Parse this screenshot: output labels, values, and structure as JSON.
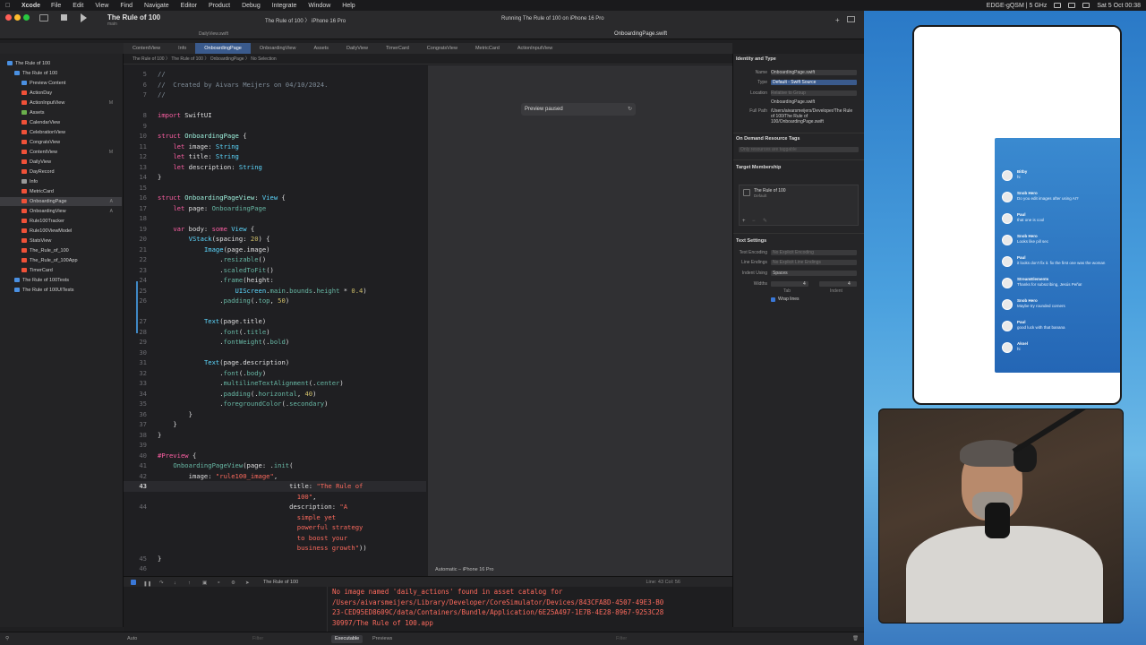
{
  "menubar": {
    "app": "Xcode",
    "items": [
      "File",
      "Edit",
      "View",
      "Find",
      "Navigate",
      "Editor",
      "Product",
      "Debug",
      "Integrate",
      "Window",
      "Help"
    ],
    "network": "EDGE-gQSM | 5 GHz",
    "clock": "Sat 5 Oct 00:38"
  },
  "toolbar": {
    "project": "The Rule of 100",
    "project_sub": "main",
    "scheme": "The Rule of 100  〉  iPhone 16 Pro",
    "status": "Running The Rule of 100 on iPhone 16 Pro",
    "active_file": "OnboardingPage.swift",
    "daily_tab": "DailyView.swift"
  },
  "tabs": [
    "ContentView",
    "Info",
    "OnboardingPage",
    "OnboardingView",
    "Assets",
    "DailyView",
    "TimerCard",
    "CongratsView",
    "MetricCard",
    "ActionInputView"
  ],
  "jumpbar": "The Rule of 100  〉  The Rule of 100  〉  OnboardingPage  〉  No Selection",
  "navigator": {
    "items": [
      {
        "label": "The Rule of 100",
        "indent": 0,
        "kind": "project",
        "badge": ""
      },
      {
        "label": "The Rule of 100",
        "indent": 1,
        "kind": "folder",
        "badge": ""
      },
      {
        "label": "Preview Content",
        "indent": 2,
        "kind": "folder",
        "badge": ""
      },
      {
        "label": "ActionDay",
        "indent": 2,
        "kind": "swift",
        "badge": ""
      },
      {
        "label": "ActionInputView",
        "indent": 2,
        "kind": "swift",
        "badge": "M"
      },
      {
        "label": "Assets",
        "indent": 2,
        "kind": "asset",
        "badge": ""
      },
      {
        "label": "CalendarView",
        "indent": 2,
        "kind": "swift",
        "badge": ""
      },
      {
        "label": "CelebrationView",
        "indent": 2,
        "kind": "swift",
        "badge": ""
      },
      {
        "label": "CongratsView",
        "indent": 2,
        "kind": "swift",
        "badge": ""
      },
      {
        "label": "ContentView",
        "indent": 2,
        "kind": "swift",
        "badge": "M"
      },
      {
        "label": "DailyView",
        "indent": 2,
        "kind": "swift",
        "badge": ""
      },
      {
        "label": "DayRecord",
        "indent": 2,
        "kind": "swift",
        "badge": ""
      },
      {
        "label": "Info",
        "indent": 2,
        "kind": "plist",
        "badge": ""
      },
      {
        "label": "MetricCard",
        "indent": 2,
        "kind": "swift",
        "badge": ""
      },
      {
        "label": "OnboardingPage",
        "indent": 2,
        "kind": "swift",
        "badge": "A"
      },
      {
        "label": "OnboardingView",
        "indent": 2,
        "kind": "swift",
        "badge": "A"
      },
      {
        "label": "Rule100Tracker",
        "indent": 2,
        "kind": "swift",
        "badge": ""
      },
      {
        "label": "Rule100ViewModel",
        "indent": 2,
        "kind": "swift",
        "badge": ""
      },
      {
        "label": "StatsView",
        "indent": 2,
        "kind": "swift",
        "badge": ""
      },
      {
        "label": "The_Rule_of_100",
        "indent": 2,
        "kind": "swift",
        "badge": ""
      },
      {
        "label": "The_Rule_of_100App",
        "indent": 2,
        "kind": "swift",
        "badge": ""
      },
      {
        "label": "TimerCard",
        "indent": 2,
        "kind": "swift",
        "badge": ""
      },
      {
        "label": "The Rule of 100Tests",
        "indent": 1,
        "kind": "folder",
        "badge": ""
      },
      {
        "label": "The Rule of 100UITests",
        "indent": 1,
        "kind": "folder",
        "badge": ""
      }
    ],
    "selected_index": 14
  },
  "code": [
    {
      "n": "5",
      "h": "<span class=\"cm\">//</span>"
    },
    {
      "n": "6",
      "h": "<span class=\"cm\">//  Created by Aivars Meijers on 04/10/2024.</span>"
    },
    {
      "n": "7",
      "h": "<span class=\"cm\">//</span>"
    },
    {
      "n": "",
      "h": ""
    },
    {
      "n": "8",
      "h": "<span class=\"kw\">import</span> <span class=\"pl\">SwiftUI</span>"
    },
    {
      "n": "9",
      "h": ""
    },
    {
      "n": "10",
      "h": "<span class=\"kw\">struct</span> <span class=\"cls\">OnboardingPage</span> <span class=\"pl\">{</span>"
    },
    {
      "n": "11",
      "h": "    <span class=\"kw\">let</span> <span class=\"pl\">image:</span> <span class=\"ty\">String</span>"
    },
    {
      "n": "12",
      "h": "    <span class=\"kw\">let</span> <span class=\"pl\">title:</span> <span class=\"ty\">String</span>"
    },
    {
      "n": "13",
      "h": "    <span class=\"kw\">let</span> <span class=\"pl\">description:</span> <span class=\"ty\">String</span>"
    },
    {
      "n": "14",
      "h": "<span class=\"pl\">}</span>"
    },
    {
      "n": "15",
      "h": ""
    },
    {
      "n": "16",
      "h": "<span class=\"kw\">struct</span> <span class=\"cls\">OnboardingPageView</span><span class=\"pl\">:</span> <span class=\"ty\">View</span> <span class=\"pl\">{</span>"
    },
    {
      "n": "17",
      "h": "    <span class=\"kw\">let</span> <span class=\"pl\">page:</span> <span class=\"fn\">OnboardingPage</span>"
    },
    {
      "n": "18",
      "h": ""
    },
    {
      "n": "19",
      "h": "    <span class=\"kw\">var</span> <span class=\"pl\">body:</span> <span class=\"kw\">some</span> <span class=\"ty\">View</span> <span class=\"pl\">{</span>"
    },
    {
      "n": "20",
      "h": "        <span class=\"ty\">VStack</span><span class=\"pl\">(spacing:</span> <span class=\"nu\">20</span><span class=\"pl\">) {</span>"
    },
    {
      "n": "21",
      "h": "            <span class=\"ty\">Image</span><span class=\"pl\">(page.image)</span>"
    },
    {
      "n": "22",
      "h": "                <span class=\"pl\">.</span><span class=\"fn\">resizable</span><span class=\"pl\">()</span>"
    },
    {
      "n": "23",
      "h": "                <span class=\"pl\">.</span><span class=\"fn\">scaledToFit</span><span class=\"pl\">()</span>"
    },
    {
      "n": "24",
      "h": "                <span class=\"pl\">.</span><span class=\"fn\">frame</span><span class=\"pl\">(height:</span>"
    },
    {
      "n": "25",
      "h": "                    <span class=\"ty\">UIScreen</span><span class=\"pl\">.</span><span class=\"fn\">main</span><span class=\"pl\">.</span><span class=\"fn\">bounds</span><span class=\"pl\">.</span><span class=\"fn\">height</span> <span class=\"pl\">*</span> <span class=\"nu\">0.4</span><span class=\"pl\">)</span>"
    },
    {
      "n": "26",
      "h": "                <span class=\"pl\">.</span><span class=\"fn\">padding</span><span class=\"pl\">(.</span><span class=\"fn\">top</span><span class=\"pl\">,</span> <span class=\"nu\">50</span><span class=\"pl\">)</span>"
    },
    {
      "n": "",
      "h": ""
    },
    {
      "n": "27",
      "h": "            <span class=\"ty\">Text</span><span class=\"pl\">(page.title)</span>"
    },
    {
      "n": "28",
      "h": "                <span class=\"pl\">.</span><span class=\"fn\">font</span><span class=\"pl\">(.</span><span class=\"fn\">title</span><span class=\"pl\">)</span>"
    },
    {
      "n": "29",
      "h": "                <span class=\"pl\">.</span><span class=\"fn\">fontWeight</span><span class=\"pl\">(.</span><span class=\"fn\">bold</span><span class=\"pl\">)</span>"
    },
    {
      "n": "30",
      "h": ""
    },
    {
      "n": "31",
      "h": "            <span class=\"ty\">Text</span><span class=\"pl\">(page.description)</span>"
    },
    {
      "n": "32",
      "h": "                <span class=\"pl\">.</span><span class=\"fn\">font</span><span class=\"pl\">(.</span><span class=\"fn\">body</span><span class=\"pl\">)</span>"
    },
    {
      "n": "33",
      "h": "                <span class=\"pl\">.</span><span class=\"fn\">multilineTextAlignment</span><span class=\"pl\">(.</span><span class=\"fn\">center</span><span class=\"pl\">)</span>"
    },
    {
      "n": "34",
      "h": "                <span class=\"pl\">.</span><span class=\"fn\">padding</span><span class=\"pl\">(.</span><span class=\"fn\">horizontal</span><span class=\"pl\">,</span> <span class=\"nu\">40</span><span class=\"pl\">)</span>"
    },
    {
      "n": "35",
      "h": "                <span class=\"pl\">.</span><span class=\"fn\">foregroundColor</span><span class=\"pl\">(.</span><span class=\"fn\">secondary</span><span class=\"pl\">)</span>"
    },
    {
      "n": "36",
      "h": "        <span class=\"pl\">}</span>"
    },
    {
      "n": "37",
      "h": "    <span class=\"pl\">}</span>"
    },
    {
      "n": "38",
      "h": "<span class=\"pl\">}</span>"
    },
    {
      "n": "39",
      "h": ""
    },
    {
      "n": "40",
      "h": "<span class=\"kw\">#Preview</span> <span class=\"pl\">{</span>"
    },
    {
      "n": "41",
      "h": "    <span class=\"fn\">OnboardingPageView</span><span class=\"pl\">(page: .</span><span class=\"fn\">init</span><span class=\"pl\">(</span>"
    },
    {
      "n": "42",
      "h": "        <span class=\"pl\">image:</span> <span class=\"st\">\"rule100_image\"</span><span class=\"pl\">,</span>"
    },
    {
      "n": "43",
      "h": "                                  <span class=\"pl\">title:</span> <span class=\"st\">\"The Rule of</span>",
      "cur": true
    },
    {
      "n": "",
      "h": "                                    <span class=\"st\">100\"</span><span class=\"pl\">,</span>"
    },
    {
      "n": "44",
      "h": "                                  <span class=\"pl\">description:</span> <span class=\"st\">\"A</span>"
    },
    {
      "n": "",
      "h": "                                    <span class=\"st\">simple yet</span>"
    },
    {
      "n": "",
      "h": "                                    <span class=\"st\">powerful strategy</span>"
    },
    {
      "n": "",
      "h": "                                    <span class=\"st\">to boost your</span>"
    },
    {
      "n": "",
      "h": "                                    <span class=\"st\">business growth\"</span><span class=\"pl\">))</span>"
    },
    {
      "n": "45",
      "h": "<span class=\"pl\">}</span>"
    },
    {
      "n": "46",
      "h": ""
    }
  ],
  "preview": {
    "paused_label": "Preview paused",
    "device": "Automatic – iPhone 16 Pro"
  },
  "inspector": {
    "identity_header": "Identity and Type",
    "name_label": "Name",
    "name_value": "OnboardingPage.swift",
    "type_label": "Type",
    "type_value": "Default - Swift Source",
    "location_label": "Location",
    "location_value": "Relative to Group",
    "location_file": "OnboardingPage.swift",
    "fullpath_label": "Full Path",
    "fullpath_value": "/Users/aivarsmeijers/Developer/The Rule of 100/The Rule of 100/OnboardingPage.swift",
    "odr_header": "On Demand Resource Tags",
    "odr_placeholder": "Only resources are taggable",
    "tm_header": "Target Membership",
    "tm_target": "The Rule of 100",
    "tm_sub": "Default",
    "ts_header": "Text Settings",
    "encoding_label": "Text Encoding",
    "encoding_value": "No Explicit Encoding",
    "endings_label": "Line Endings",
    "endings_value": "No Explicit Line Endings",
    "indent_label": "Indent Using",
    "indent_value": "Spaces",
    "widths_label": "Widths",
    "tab_label": "Tab",
    "indent_label2": "Indent",
    "tab_value": "4",
    "indent_value2": "4",
    "wrap_label": "Wrap lines"
  },
  "debug": {
    "target": "The Rule of 100",
    "console_lines": [
      "No image named 'daily_actions' found in asset catalog for",
      "/Users/aivarsmeijers/Library/Developer/CoreSimulator/Devices/843CFA8D-4507-49E3-B0",
      "23-CED95ED8609C/data/Containers/Bundle/Application/6E25A497-1E7B-4E28-8967-9253C28",
      "30997/The Rule of 100.app"
    ],
    "auto_label": "Auto",
    "filter_placeholder": "Filter",
    "executable_label": "Executable",
    "previews_label": "Previews",
    "position": "Line: 43  Col: 56"
  },
  "stream": {
    "chats": [
      {
        "name": "Bitby",
        "msg": "hi"
      },
      {
        "name": "Snob Hero",
        "msg": "Do you edit images after using AI?"
      },
      {
        "name": "Paul",
        "msg": "that one is cool"
      },
      {
        "name": "Snob Hero",
        "msg": "Looks like pill sec"
      },
      {
        "name": "Paul",
        "msg": "it looks don't fix it. fix the first one was the woman"
      },
      {
        "name": "StreamElements",
        "msg": "Thanks for subscribing, Jesús Peña!"
      },
      {
        "name": "Snob Hero",
        "msg": "Maybe try rounded corners"
      },
      {
        "name": "Paul",
        "msg": "good luck with that banana"
      },
      {
        "name": "Aksel",
        "msg": "hi"
      }
    ]
  },
  "colors": {
    "accent": "#3a5a8c",
    "string": "#fc6a5d",
    "keyword": "#fc5fa3",
    "type": "#5dd8ff"
  }
}
